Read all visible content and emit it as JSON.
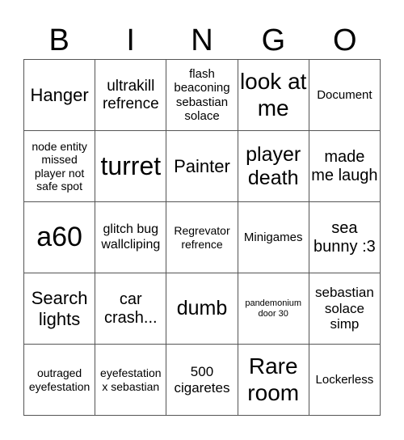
{
  "header": {
    "letters": [
      "B",
      "I",
      "N",
      "G",
      "O"
    ]
  },
  "cells": [
    [
      "Hanger",
      "ultrakill refrence",
      "flash beaconing sebastian solace",
      "look at me",
      "Document"
    ],
    [
      "node entity missed player not safe spot",
      "turret",
      "Painter",
      "player death",
      "made me laugh"
    ],
    [
      "a60",
      "glitch bug wallcliping",
      "Regrevator refrence",
      "Minigames",
      "sea bunny :3"
    ],
    [
      "Search lights",
      "car crash...",
      "dumb",
      "pandemonium door 30",
      "sebastian solace simp"
    ],
    [
      "outraged eyefestation",
      "eyefestation x sebastian",
      "500 cigaretes",
      "Rare room",
      "Lockerless"
    ]
  ]
}
